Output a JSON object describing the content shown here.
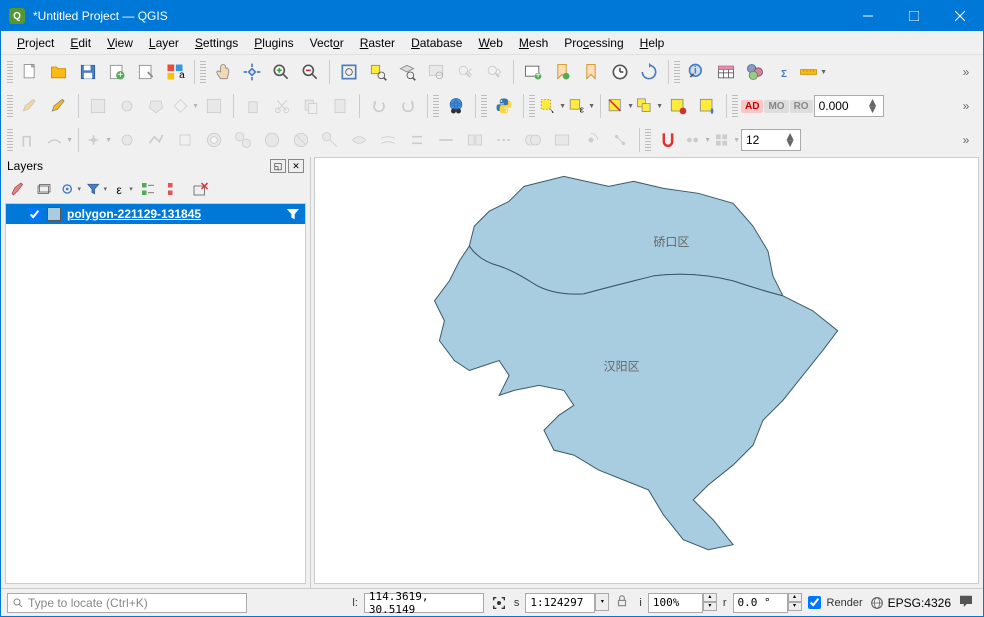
{
  "window": {
    "title": "*Untitled Project — QGIS",
    "logo": "Q"
  },
  "menu": [
    "Project",
    "Edit",
    "View",
    "Layer",
    "Settings",
    "Plugins",
    "Vector",
    "Raster",
    "Database",
    "Web",
    "Mesh",
    "Processing",
    "Help"
  ],
  "toolbar2": {
    "spinner": "0.000",
    "badges": {
      "ad": "AD",
      "mo": "MO",
      "ro": "RO"
    }
  },
  "toolbar3": {
    "snap_value": "12"
  },
  "layers_panel": {
    "title": "Layers",
    "layer": {
      "name": "polygon-221129-131845",
      "checked": true
    }
  },
  "map": {
    "labels": [
      "硚口区",
      "汉阳区"
    ]
  },
  "statusbar": {
    "locator_placeholder": "Type to locate (Ctrl+K)",
    "coords_label": "",
    "coords": "114.3619, 30.5149",
    "scale_label": "s",
    "scale": "1:124297",
    "mag_label": "i",
    "mag": "100%",
    "rot_label": "r",
    "rot": "0.0 °",
    "render": "Render",
    "crs": "EPSG:4326"
  }
}
